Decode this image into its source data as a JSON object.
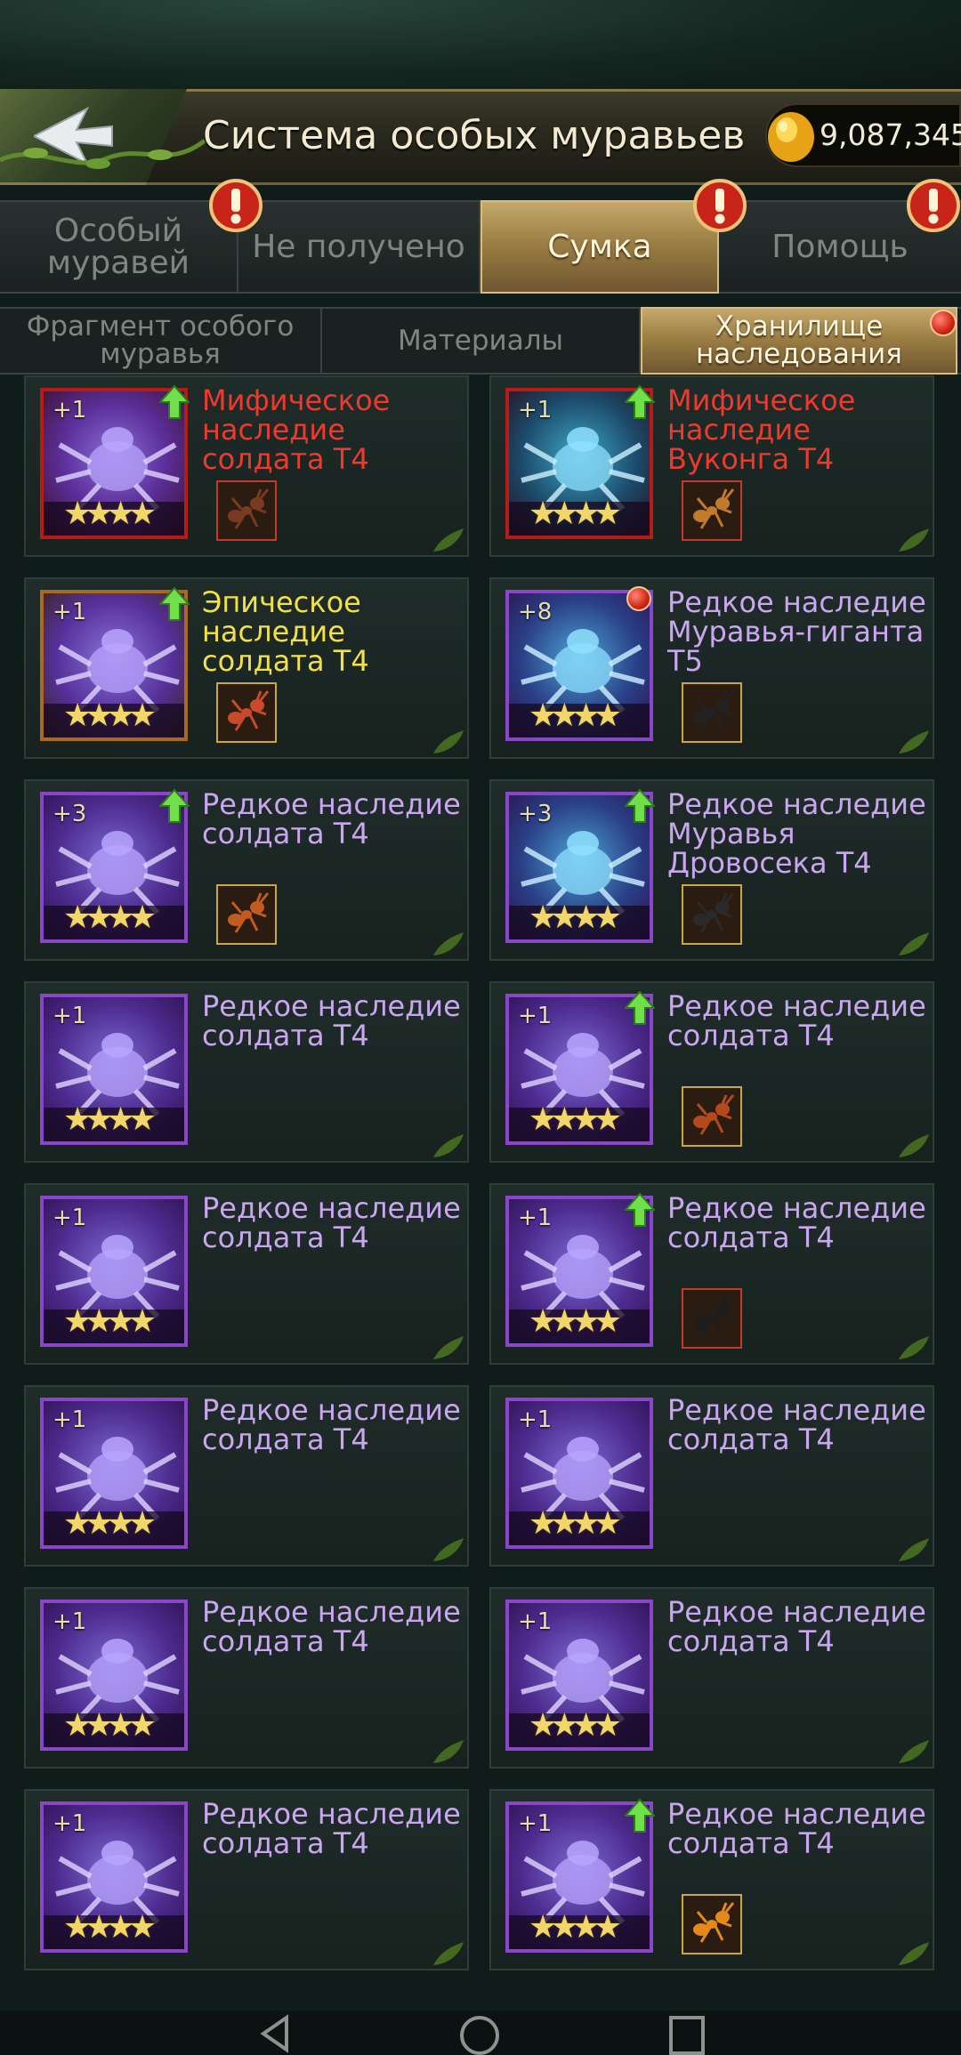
{
  "header": {
    "title": "Система особых муравьев",
    "gold": "9,087,345"
  },
  "tabs": [
    {
      "label": "Особый\nмуравей",
      "active": false,
      "alert": true
    },
    {
      "label": "Не получено",
      "active": false,
      "alert": false
    },
    {
      "label": "Сумка",
      "active": true,
      "alert": true
    },
    {
      "label": "Помощь",
      "active": false,
      "alert": true
    }
  ],
  "subtabs": [
    {
      "label": "Фрагмент особого\nмуравья",
      "active": false
    },
    {
      "label": "Материалы",
      "active": false
    },
    {
      "label": "Хранилище\nнаследования",
      "active": true,
      "dot": true
    }
  ],
  "items": [
    {
      "level": "+1",
      "name": "Мифическое\nнаследие\nсолдата T4",
      "rarity": "mythic",
      "upgrade": true
    },
    {
      "level": "+1",
      "name": "Мифическое\nнаследие\nВуконга T4",
      "rarity": "mythic",
      "upgrade": true
    },
    {
      "level": "+1",
      "name": "Эпическое\nнаследие\nсолдата T4",
      "rarity": "epic",
      "upgrade": true
    },
    {
      "level": "+8",
      "name": "Редкое наследие\nМуравья-гиганта\nT5",
      "rarity": "rare",
      "upgrade": false,
      "dot": true
    },
    {
      "level": "+3",
      "name": "Редкое наследие\nсолдата T4",
      "rarity": "rare",
      "upgrade": true
    },
    {
      "level": "+3",
      "name": "Редкое наследие\nМуравья\nДровосека T4",
      "rarity": "rare",
      "upgrade": true
    },
    {
      "level": "+1",
      "name": "Редкое наследие\nсолдата T4",
      "rarity": "rare",
      "upgrade": false
    },
    {
      "level": "+1",
      "name": "Редкое наследие\nсолдата T4",
      "rarity": "rare",
      "upgrade": true
    },
    {
      "level": "+1",
      "name": "Редкое наследие\nсолдата T4",
      "rarity": "rare",
      "upgrade": false
    },
    {
      "level": "+1",
      "name": "Редкое наследие\nсолдата T4",
      "rarity": "rare",
      "upgrade": true
    },
    {
      "level": "+1",
      "name": "Редкое наследие\nсолдата T4",
      "rarity": "rare",
      "upgrade": false
    },
    {
      "level": "+1",
      "name": "Редкое наследие\nсолдата T4",
      "rarity": "rare",
      "upgrade": false
    },
    {
      "level": "+1",
      "name": "Редкое наследие\nсолдата T4",
      "rarity": "rare",
      "upgrade": false
    },
    {
      "level": "+1",
      "name": "Редкое наследие\nсолдата T4",
      "rarity": "rare",
      "upgrade": false
    },
    {
      "level": "+1",
      "name": "Редкое наследие\nсолдата T4",
      "rarity": "rare",
      "upgrade": false
    },
    {
      "level": "+1",
      "name": "Редкое наследие\nсолдата T4",
      "rarity": "rare",
      "upgrade": true
    }
  ],
  "colors": {
    "mythic": "#ee3a2c",
    "epic": "#f2e04a",
    "rare": "#c9a6ef",
    "tab_active": "#c6a86a"
  }
}
